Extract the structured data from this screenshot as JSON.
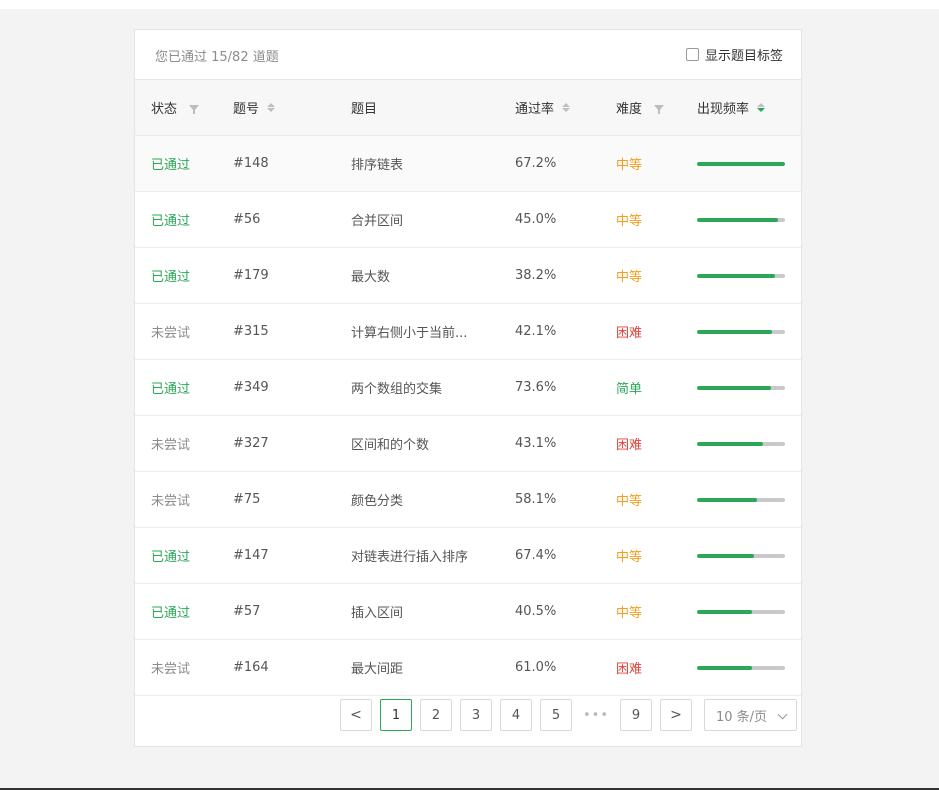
{
  "header": {
    "summary": "您已通过 15/82 道题",
    "show_tags_label": "显示题目标签"
  },
  "columns": {
    "status": "状态",
    "number": "题号",
    "title": "题目",
    "pass_rate": "通过率",
    "difficulty": "难度",
    "frequency": "出现频率"
  },
  "colors": {
    "green": "#2aa858",
    "medium": "#f0a020",
    "hard": "#e0433a",
    "easy": "#2aa858",
    "muted": "#8c8c8c"
  },
  "rows": [
    {
      "status": "已通过",
      "number": "#148",
      "title": "排序链表",
      "pass_rate": "67.2%",
      "difficulty": "中等",
      "level": "medium",
      "frequency": 1.0
    },
    {
      "status": "已通过",
      "number": "#56",
      "title": "合并区间",
      "pass_rate": "45.0%",
      "difficulty": "中等",
      "level": "medium",
      "frequency": 0.92
    },
    {
      "status": "已通过",
      "number": "#179",
      "title": "最大数",
      "pass_rate": "38.2%",
      "difficulty": "中等",
      "level": "medium",
      "frequency": 0.89
    },
    {
      "status": "未尝试",
      "number": "#315",
      "title": "计算右侧小于当前...",
      "pass_rate": "42.1%",
      "difficulty": "困难",
      "level": "hard",
      "frequency": 0.85
    },
    {
      "status": "已通过",
      "number": "#349",
      "title": "两个数组的交集",
      "pass_rate": "73.6%",
      "difficulty": "简单",
      "level": "easy",
      "frequency": 0.84
    },
    {
      "status": "未尝试",
      "number": "#327",
      "title": "区间和的个数",
      "pass_rate": "43.1%",
      "difficulty": "困难",
      "level": "hard",
      "frequency": 0.75
    },
    {
      "status": "未尝试",
      "number": "#75",
      "title": "颜色分类",
      "pass_rate": "58.1%",
      "difficulty": "中等",
      "level": "medium",
      "frequency": 0.68
    },
    {
      "status": "已通过",
      "number": "#147",
      "title": "对链表进行插入排序",
      "pass_rate": "67.4%",
      "difficulty": "中等",
      "level": "medium",
      "frequency": 0.65
    },
    {
      "status": "已通过",
      "number": "#57",
      "title": "插入区间",
      "pass_rate": "40.5%",
      "difficulty": "中等",
      "level": "medium",
      "frequency": 0.63
    },
    {
      "status": "未尝试",
      "number": "#164",
      "title": "最大间距",
      "pass_rate": "61.0%",
      "difficulty": "困难",
      "level": "hard",
      "frequency": 0.63
    }
  ],
  "pagination": {
    "prev": "<",
    "pages": [
      "1",
      "2",
      "3",
      "4",
      "5"
    ],
    "ellipsis": "•••",
    "last": "9",
    "next": ">",
    "current": "1",
    "page_size": "10 条/页"
  }
}
